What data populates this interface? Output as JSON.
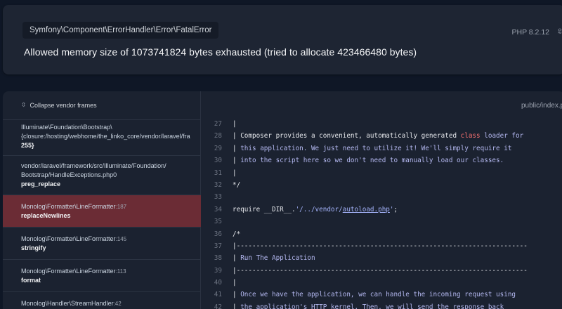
{
  "header": {
    "exception_class": "Symfony\\Component\\ErrorHandler\\Error\\FatalError",
    "message": "Allowed memory size of 1073741824 bytes exhausted (tried to allocate 423466480 bytes)",
    "php_version": "PHP 8.2.12",
    "php_icon": "laravel-icon"
  },
  "frames_panel": {
    "collapse_label": "Collapse vendor frames",
    "collapse_icon": "collapse-arrows-icon",
    "frames": [
      {
        "file": "Illuminate\\Foundation\\Bootstrap\\",
        "file2": "{closure:/hosting/webhome/the_linko_core/vendor/laravel/fra",
        "line": "",
        "function": "255}"
      },
      {
        "file": "vendor/laravel/framework/src/Illuminate/Foundation/",
        "file2": "Bootstrap/HandleExceptions.php",
        "line": "0",
        "function": "preg_replace"
      },
      {
        "file": "Monolog\\Formatter\\LineFormatter",
        "file2": "",
        "line": "187",
        "function": "replaceNewlines"
      },
      {
        "file": "Monolog\\Formatter\\LineFormatter",
        "file2": "",
        "line": "145",
        "function": "stringify"
      },
      {
        "file": "Monolog\\Formatter\\LineFormatter",
        "file2": "",
        "line": "113",
        "function": "format"
      },
      {
        "file": "Monolog\\Handler\\StreamHandler",
        "file2": "",
        "line": "42",
        "function": ""
      }
    ]
  },
  "code_panel": {
    "file_path": "public/index.php",
    "lines": [
      {
        "num": "27",
        "text": "|"
      },
      {
        "num": "28",
        "text": "| Composer provides a convenient, automatically generated class loader for"
      },
      {
        "num": "29",
        "text": "| this application. We just need to utilize it! We'll simply require it"
      },
      {
        "num": "30",
        "text": "| into the script here so we don't need to manually load our classes."
      },
      {
        "num": "31",
        "text": "|"
      },
      {
        "num": "32",
        "text": "*/"
      },
      {
        "num": "33",
        "text": ""
      },
      {
        "num": "34",
        "text": "require __DIR__.'/../vendor/autoload.php';"
      },
      {
        "num": "35",
        "text": ""
      },
      {
        "num": "36",
        "text": "/*"
      },
      {
        "num": "37",
        "text": "|--------------------------------------------------------------------------"
      },
      {
        "num": "38",
        "text": "| Run The Application"
      },
      {
        "num": "39",
        "text": "|--------------------------------------------------------------------------"
      },
      {
        "num": "40",
        "text": "|"
      },
      {
        "num": "41",
        "text": "| Once we have the application, we can handle the incoming request using"
      },
      {
        "num": "42",
        "text": "| the application's HTTP kernel. Then, we will send the response back"
      }
    ]
  },
  "colors": {
    "background": "#0f1726",
    "card": "#1e2533",
    "active_frame": "#6b2c35",
    "comment": "#b4b8f0",
    "keyword": "#f87171"
  }
}
